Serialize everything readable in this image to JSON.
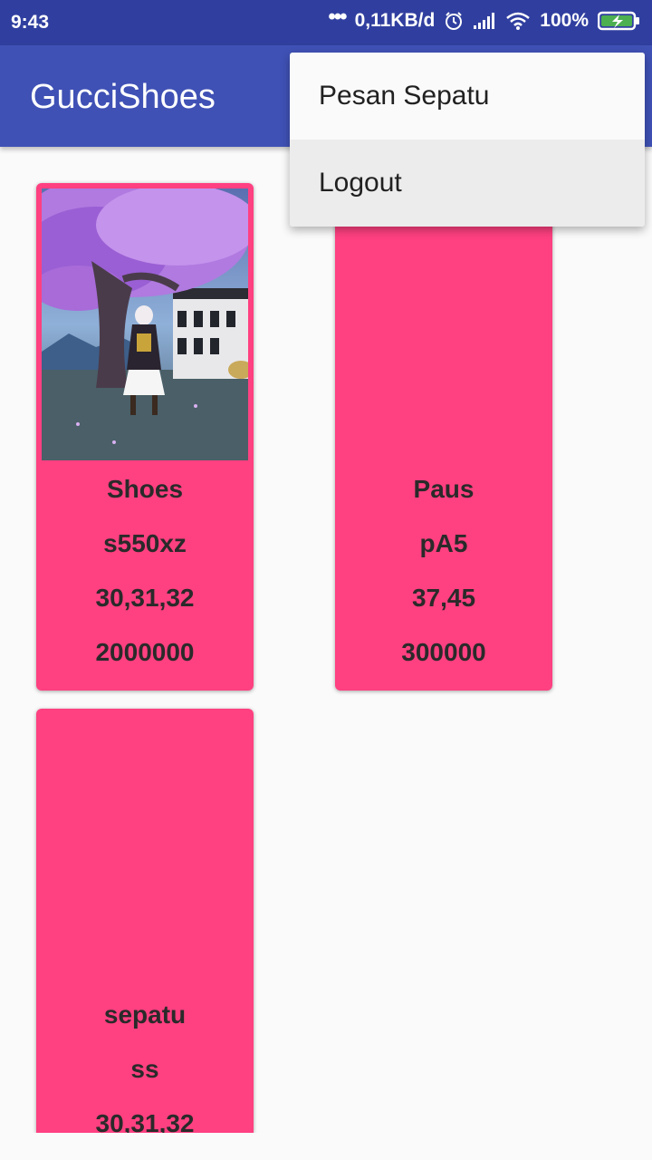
{
  "status_bar": {
    "time": "9:43",
    "dots": "•••",
    "network_speed": "0,11KB/d",
    "battery_percent": "100%",
    "icons": [
      "alarm-icon",
      "signal-icon",
      "wifi-icon",
      "battery-icon"
    ]
  },
  "toolbar": {
    "title": "GucciShoes"
  },
  "menu": {
    "items": [
      {
        "label": "Pesan Sepatu"
      },
      {
        "label": "Logout"
      }
    ]
  },
  "products": [
    {
      "name": "Shoes",
      "code": "s550xz",
      "sizes": "30,31,32",
      "price": "2000000",
      "has_image": true
    },
    {
      "name": "Paus",
      "code": "pA5",
      "sizes": "37,45",
      "price": "300000",
      "has_image": false
    },
    {
      "name": "sepatu",
      "code": "ss",
      "sizes": "30,31,32",
      "price": "",
      "has_image": false
    }
  ],
  "colors": {
    "status_bar": "#303f9f",
    "toolbar": "#3f51b5",
    "card": "#ff4081",
    "background": "#fafafa"
  }
}
